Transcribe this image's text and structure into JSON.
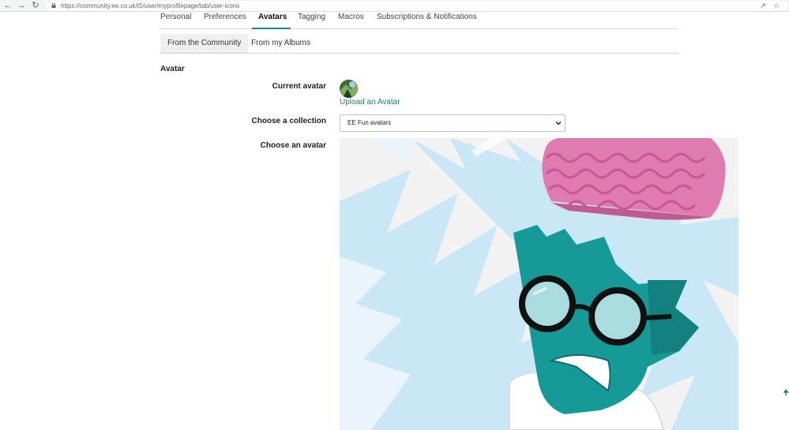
{
  "browser": {
    "url": "https://community.ee.co.uk/t5/user/myprofilepage/tab/user-icons"
  },
  "tabs": [
    {
      "label": "Personal"
    },
    {
      "label": "Preferences"
    },
    {
      "label": "Avatars"
    },
    {
      "label": "Tagging"
    },
    {
      "label": "Macros"
    },
    {
      "label": "Subscriptions & Notifications"
    }
  ],
  "subtabs": [
    {
      "label": "From the Community"
    },
    {
      "label": "From my Albums"
    }
  ],
  "section": {
    "title": "Avatar"
  },
  "form": {
    "current_avatar_label": "Current avatar",
    "upload_link": "Upload an Avatar",
    "collection_label": "Choose a collection",
    "collection_value": "EE Fun avatars",
    "choose_label": "Choose an avatar"
  },
  "colors": {
    "accent": "#0d8a85",
    "link": "#1e7f7a",
    "teal_character": "#169a98",
    "brain_pink": "#e07bb0"
  }
}
